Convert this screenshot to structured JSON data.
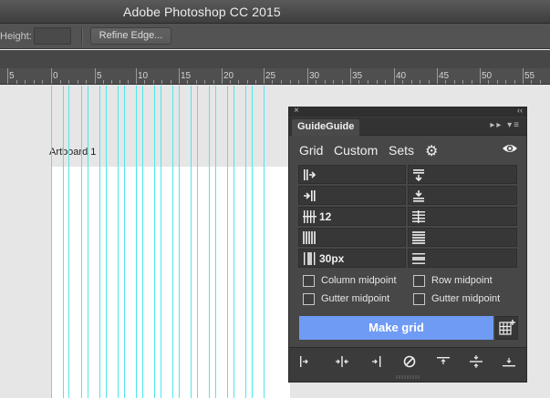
{
  "app": {
    "title": "Adobe Photoshop CC 2015"
  },
  "options": {
    "height_label": "Height:",
    "refine_edge_label": "Refine Edge..."
  },
  "ruler": {
    "labels": [
      "5",
      "0",
      "5",
      "10",
      "15",
      "20",
      "25",
      "30",
      "35",
      "40",
      "45",
      "50",
      "55"
    ]
  },
  "canvas": {
    "artboard_name": "Artboard 1"
  },
  "panel": {
    "title": "GuideGuide",
    "nav": {
      "grid": "Grid",
      "custom": "Custom",
      "sets": "Sets"
    },
    "fields": {
      "columns_value": "12",
      "gutter_value": "30px"
    },
    "checkboxes": {
      "column_midpoint": "Column midpoint",
      "row_midpoint": "Row midpoint",
      "gutter_midpoint_left": "Gutter midpoint",
      "gutter_midpoint_right": "Gutter midpoint"
    },
    "make_grid_label": "Make grid",
    "accent_color": "#6f9bf5",
    "guide_color": "#4fe6e9"
  }
}
